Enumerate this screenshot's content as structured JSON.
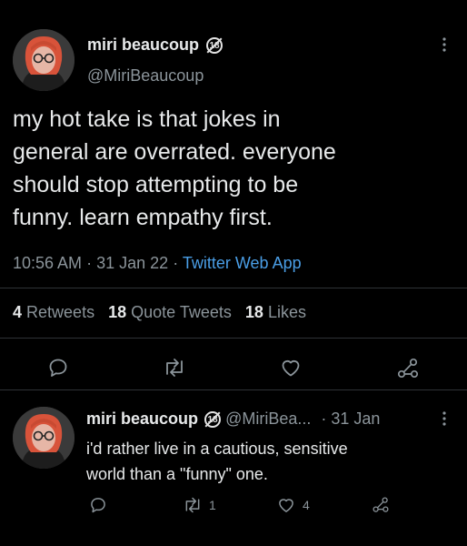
{
  "tweet": {
    "display_name": "miri beaucoup",
    "badge": "18",
    "handle": "@MiriBeaucoup",
    "text_lines": [
      "my hot take is that jokes in",
      "general are overrated. everyone",
      "should stop attempting to be",
      "funny. learn empathy first."
    ],
    "time": "10:56 AM",
    "sep1": "·",
    "date": "31 Jan 22",
    "sep2": "·",
    "source": "Twitter Web App",
    "stats": {
      "retweets_count": "4",
      "retweets_label": "Retweets",
      "quotes_count": "18",
      "quotes_label": "Quote Tweets",
      "likes_count": "18",
      "likes_label": "Likes"
    }
  },
  "reply": {
    "display_name": "miri beaucoup",
    "badge": "18",
    "handle": "@MiriBea...",
    "sep": "·",
    "date": "31 Jan",
    "text_lines": [
      "i'd rather live in a cautious, sensitive",
      "world than a \"funny\" one."
    ],
    "retweet_count": "1",
    "like_count": "4"
  },
  "icons": [
    "more-vertical-icon",
    "reply-icon",
    "retweet-icon",
    "like-icon",
    "share-icon"
  ],
  "colors": {
    "background": "#000000",
    "text": "#e7e9ea",
    "muted": "#8b949a",
    "link": "#4a9ee6",
    "divider": "#2f3336"
  }
}
